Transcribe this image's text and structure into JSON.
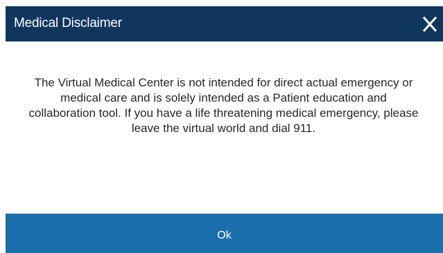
{
  "dialog": {
    "title": "Medical Disclaimer",
    "close_icon": "close-icon",
    "message": "The Virtual Medical Center is not intended for direct actual emergency or medical care and is solely intended as a Patient education and collaboration tool. If you have a life threatening medical emergency, please leave the virtual world and dial 911.",
    "ok_label": "Ok"
  },
  "colors": {
    "title_bar": "#11365d",
    "button": "#1b6faa",
    "text": "#262626",
    "background": "#ffffff"
  }
}
